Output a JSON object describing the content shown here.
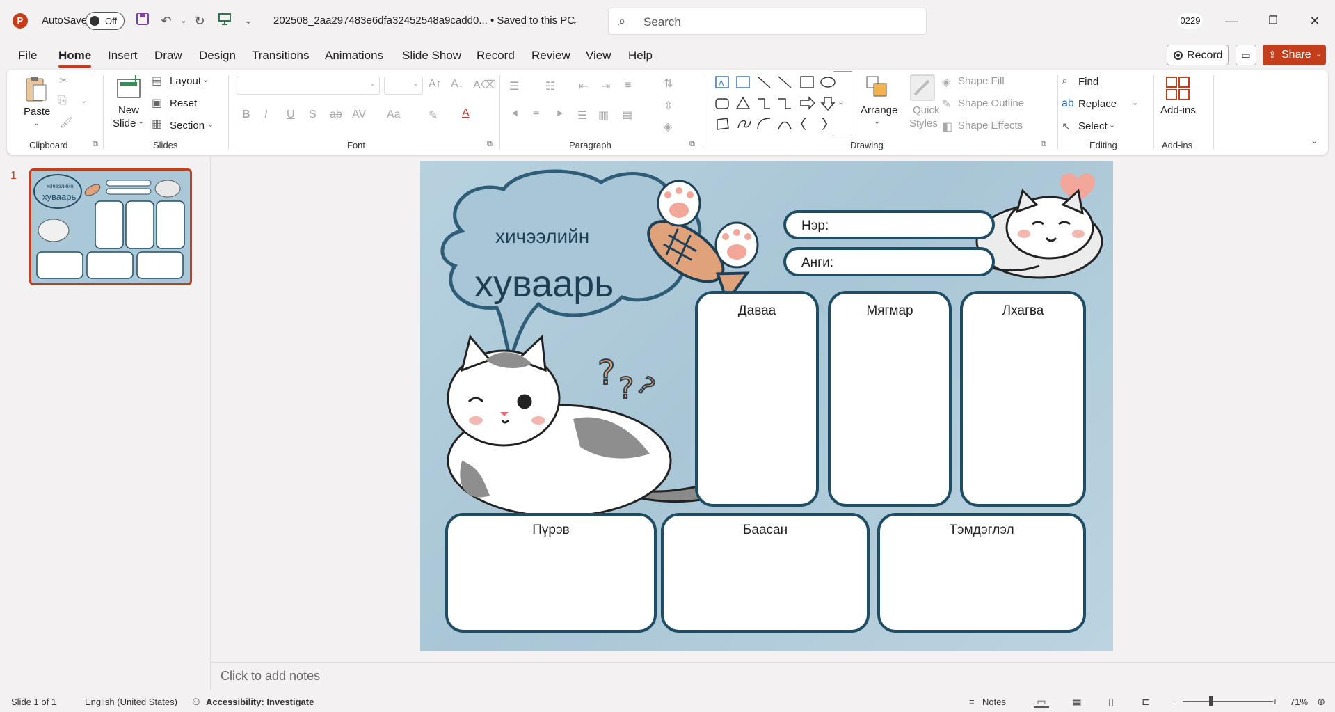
{
  "app": {
    "logo_letter": "P",
    "autosave_label": "AutoSave",
    "autosave_state": "Off",
    "document_title": "202508_2aa297483e6dfa32452548a9cadd0... • Saved to this PC",
    "search_placeholder": "Search",
    "user_badge": "0229"
  },
  "tabs": [
    "File",
    "Home",
    "Insert",
    "Draw",
    "Design",
    "Transitions",
    "Animations",
    "Slide Show",
    "Record",
    "Review",
    "View",
    "Help"
  ],
  "active_tab": "Home",
  "top_buttons": {
    "record": "Record",
    "share": "Share"
  },
  "ribbon": {
    "clipboard": {
      "paste": "Paste",
      "group": "Clipboard"
    },
    "slides": {
      "new_slide_1": "New",
      "new_slide_2": "Slide",
      "layout": "Layout",
      "reset": "Reset",
      "section": "Section",
      "group": "Slides"
    },
    "font": {
      "group": "Font",
      "bold": "B",
      "italic": "I",
      "underline": "U",
      "shadow": "S",
      "strike": "ab",
      "spacing": "AV",
      "case": "Aa",
      "color": "A"
    },
    "paragraph": {
      "group": "Paragraph"
    },
    "drawing": {
      "arrange": "Arrange",
      "quick_styles_1": "Quick",
      "quick_styles_2": "Styles",
      "shape_fill": "Shape Fill",
      "shape_outline": "Shape Outline",
      "shape_effects": "Shape Effects",
      "group": "Drawing"
    },
    "editing": {
      "find": "Find",
      "replace": "Replace",
      "select": "Select",
      "group": "Editing"
    },
    "addins": {
      "label": "Add-ins",
      "group": "Add-ins"
    }
  },
  "slide_panel": {
    "slide_number": "1"
  },
  "slide": {
    "title_small": "хичээлийн",
    "title_big": "хуваарь",
    "name_label": "Нэр:",
    "class_label": "Анги:",
    "days_top": [
      "Даваа",
      "Мягмар",
      "Лхагва"
    ],
    "days_bottom": [
      "Пүрэв",
      "Баасан",
      "Тэмдэглэл"
    ]
  },
  "notes_placeholder": "Click to add notes",
  "status": {
    "slide_count": "Slide 1 of 1",
    "language": "English (United States)",
    "accessibility": "Accessibility: Investigate",
    "notes": "Notes",
    "zoom": "71%"
  },
  "colors": {
    "accent": "#c43e1c",
    "slide_bg": "#aac8d8",
    "box_border": "#1f4d65"
  }
}
